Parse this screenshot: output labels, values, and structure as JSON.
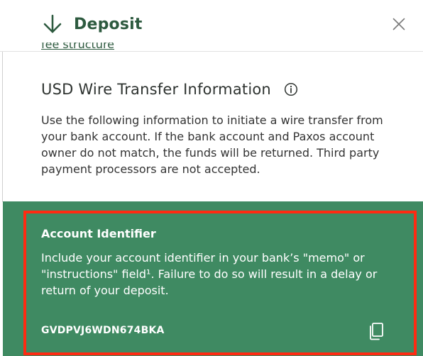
{
  "header": {
    "title": "Deposit",
    "back_icon": "arrow-down-icon",
    "close_icon": "close-icon",
    "title_color": "#2d5a3f"
  },
  "partial_link": {
    "text": "fee structure"
  },
  "wire_section": {
    "title": "USD Wire Transfer Information",
    "info_icon": "info-icon",
    "description": "Use the following information to initiate a wire transfer from your bank account. If the bank account and Paxos account owner do not match, the funds will be returned. Third party payment processors are not accepted."
  },
  "account_identifier": {
    "heading": "Account Identifier",
    "description": "Include your account identifier in your bank’s \"memo\" or \"instructions\" field¹. Failure to do so will result in a delay or return of your deposit.",
    "value": "GVDPVJ6WDN674BKA",
    "copy_icon": "copy-icon",
    "panel_color": "#3f8a62",
    "highlight_color": "#ff2a12"
  }
}
